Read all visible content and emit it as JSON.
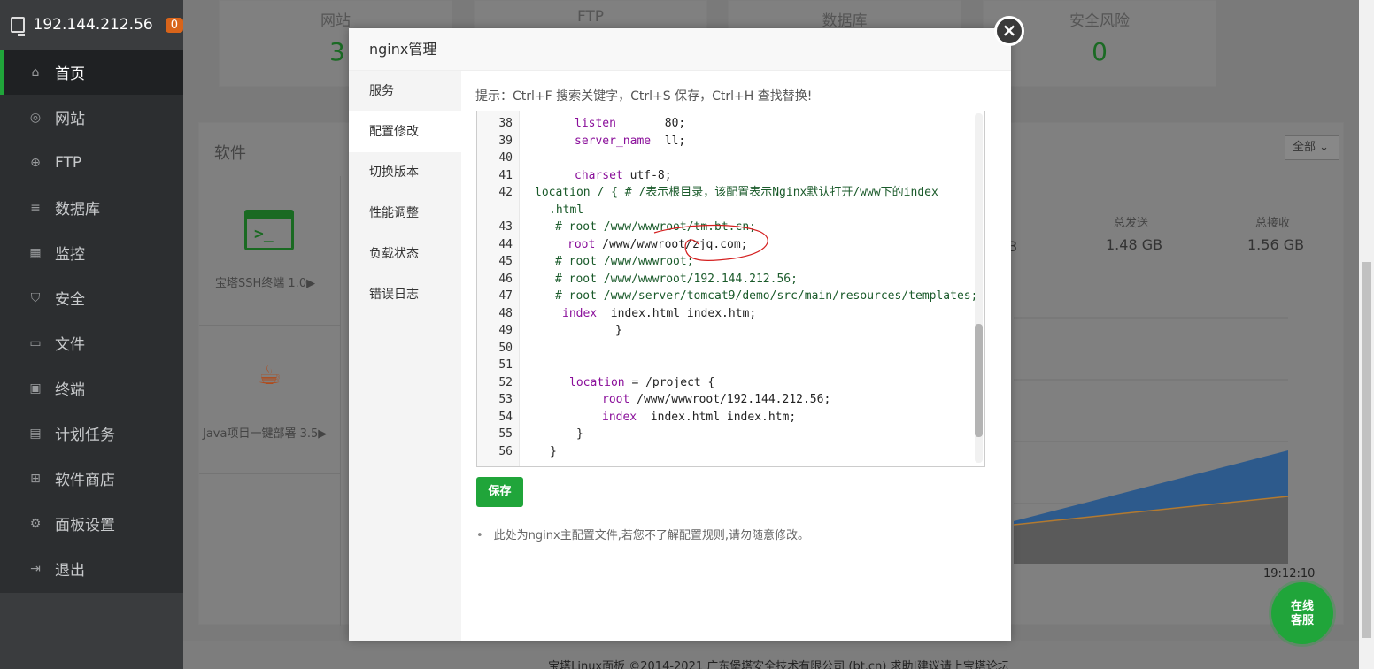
{
  "sidebar": {
    "server_ip": "192.144.212.56",
    "badge": "0",
    "items": [
      {
        "label": "首页",
        "icon": "home-icon"
      },
      {
        "label": "网站",
        "icon": "globe-icon"
      },
      {
        "label": "FTP",
        "icon": "ftp-icon"
      },
      {
        "label": "数据库",
        "icon": "database-icon"
      },
      {
        "label": "监控",
        "icon": "monitor-icon"
      },
      {
        "label": "安全",
        "icon": "shield-icon"
      },
      {
        "label": "文件",
        "icon": "folder-icon"
      },
      {
        "label": "终端",
        "icon": "terminal-icon"
      },
      {
        "label": "计划任务",
        "icon": "calendar-icon"
      },
      {
        "label": "软件商店",
        "icon": "store-icon"
      },
      {
        "label": "面板设置",
        "icon": "settings-icon"
      },
      {
        "label": "退出",
        "icon": "logout-icon"
      }
    ]
  },
  "stats": {
    "site_label": "网站",
    "site_value": "3",
    "ftp_label": "FTP",
    "db_label": "数据库",
    "risk_label": "安全风险",
    "risk_value": "0"
  },
  "software": {
    "title": "软件",
    "filter": "全部",
    "ssh": "宝塔SSH终端 1.0▶",
    "java": "Java项目一键部署 3.5▶"
  },
  "traffic": {
    "sent_label": "总发送",
    "sent_value": "1.48 GB",
    "recv_label": "总接收",
    "recv_value": "1.56 GB",
    "partial": "3",
    "time": "19:12:10"
  },
  "modal": {
    "title": "nginx管理",
    "nav": [
      "服务",
      "配置修改",
      "切换版本",
      "性能调整",
      "负载状态",
      "错误日志"
    ],
    "active_nav": 1,
    "tip": "提示：Ctrl+F 搜索关键字，Ctrl+S 保存，Ctrl+H 查找替换!",
    "save_label": "保存",
    "note": "此处为nginx主配置文件,若您不了解配置规则,请勿随意修改。",
    "code": [
      {
        "n": "38",
        "k": "listen",
        "t": "       80;"
      },
      {
        "n": "39",
        "k": "server_name",
        "t": "  ll;"
      },
      {
        "n": "40",
        "k": "",
        "t": ""
      },
      {
        "n": "41",
        "k": "charset",
        "t": " utf-8;"
      },
      {
        "n": "42",
        "k": "",
        "t": "location / { # /表示根目录，该配置表示Nginx默认打开/www下的index"
      },
      {
        "n": "",
        "k": "",
        "t": ".html"
      },
      {
        "n": "43",
        "k": "",
        "t": "# root /www/wwwroot/tm.bt.cn;"
      },
      {
        "n": "44",
        "k": "root",
        "t": " /www/wwwroot/zjq.com;"
      },
      {
        "n": "45",
        "k": "",
        "t": "# root /www/wwwroot;"
      },
      {
        "n": "46",
        "k": "",
        "t": "# root /www/wwwroot/192.144.212.56;"
      },
      {
        "n": "47",
        "k": "",
        "t": "# root /www/server/tomcat9/demo/src/main/resources/templates;"
      },
      {
        "n": "48",
        "k": "index",
        "t": "  index.html index.htm;"
      },
      {
        "n": "49",
        "k": "",
        "t": "}"
      },
      {
        "n": "50",
        "k": "",
        "t": ""
      },
      {
        "n": "51",
        "k": "",
        "t": ""
      },
      {
        "n": "52",
        "k": "location",
        "t": " = /project {"
      },
      {
        "n": "53",
        "k": "root",
        "t": " /www/wwwroot/192.144.212.56;"
      },
      {
        "n": "54",
        "k": "index",
        "t": "  index.html index.htm;"
      },
      {
        "n": "55",
        "k": "",
        "t": "}"
      },
      {
        "n": "56",
        "k": "",
        "t": "}"
      }
    ]
  },
  "service_button": "在线\n客服",
  "footer": "宝塔Linux面板 ©2014-2021 广东堡塔安全技术有限公司 (bt.cn)   求助|建议请上宝塔论坛"
}
